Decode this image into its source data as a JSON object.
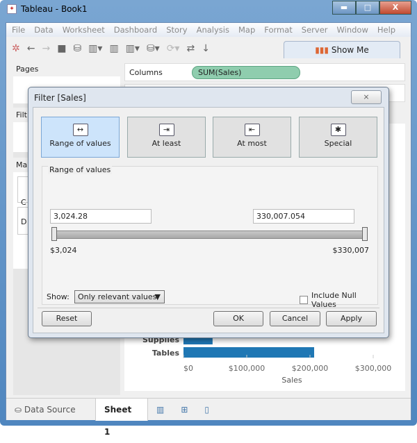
{
  "window": {
    "title": "Tableau - Book1",
    "minimize": "▬",
    "maximize": "□",
    "close": "X"
  },
  "menu": [
    "File",
    "Data",
    "Worksheet",
    "Dashboard",
    "Story",
    "Analysis",
    "Map",
    "Format",
    "Server",
    "Window",
    "Help"
  ],
  "toolbar": {
    "show_me": "Show Me"
  },
  "left": {
    "pages": "Pages",
    "filters": "Filt",
    "marks": "Ma",
    "card1": "C",
    "card2": "D"
  },
  "shelves": {
    "columns": "Columns",
    "columns_pill": "SUM(Sales)"
  },
  "chart_data": {
    "type": "bar",
    "categories": [
      "Supplies",
      "Tables"
    ],
    "values": [
      46000,
      206600
    ],
    "xlabel": "Sales",
    "ticks": [
      "$0",
      "$100,000",
      "$200,000",
      "$300,000"
    ],
    "xlim": [
      0,
      320000
    ],
    "bar_color": "#1f77b4"
  },
  "bottom": {
    "data_source": "Data Source",
    "sheet": "Sheet 1"
  },
  "dialog": {
    "title": "Filter [Sales]",
    "close": "⨯",
    "modes": [
      {
        "label": "Range of values",
        "icon": "↔"
      },
      {
        "label": "At least",
        "icon": "⇥"
      },
      {
        "label": "At most",
        "icon": "⇤"
      },
      {
        "label": "Special",
        "icon": "✱"
      }
    ],
    "group_label": "Range of values",
    "min_value": "3,024.28",
    "max_value": "330,007.054",
    "min_label": "$3,024",
    "max_label": "$330,007",
    "show_label": "Show:",
    "show_value": "Only relevant values",
    "include_null": "Include Null Values",
    "include_null_checked": false,
    "reset": "Reset",
    "ok": "OK",
    "cancel": "Cancel",
    "apply": "Apply"
  }
}
